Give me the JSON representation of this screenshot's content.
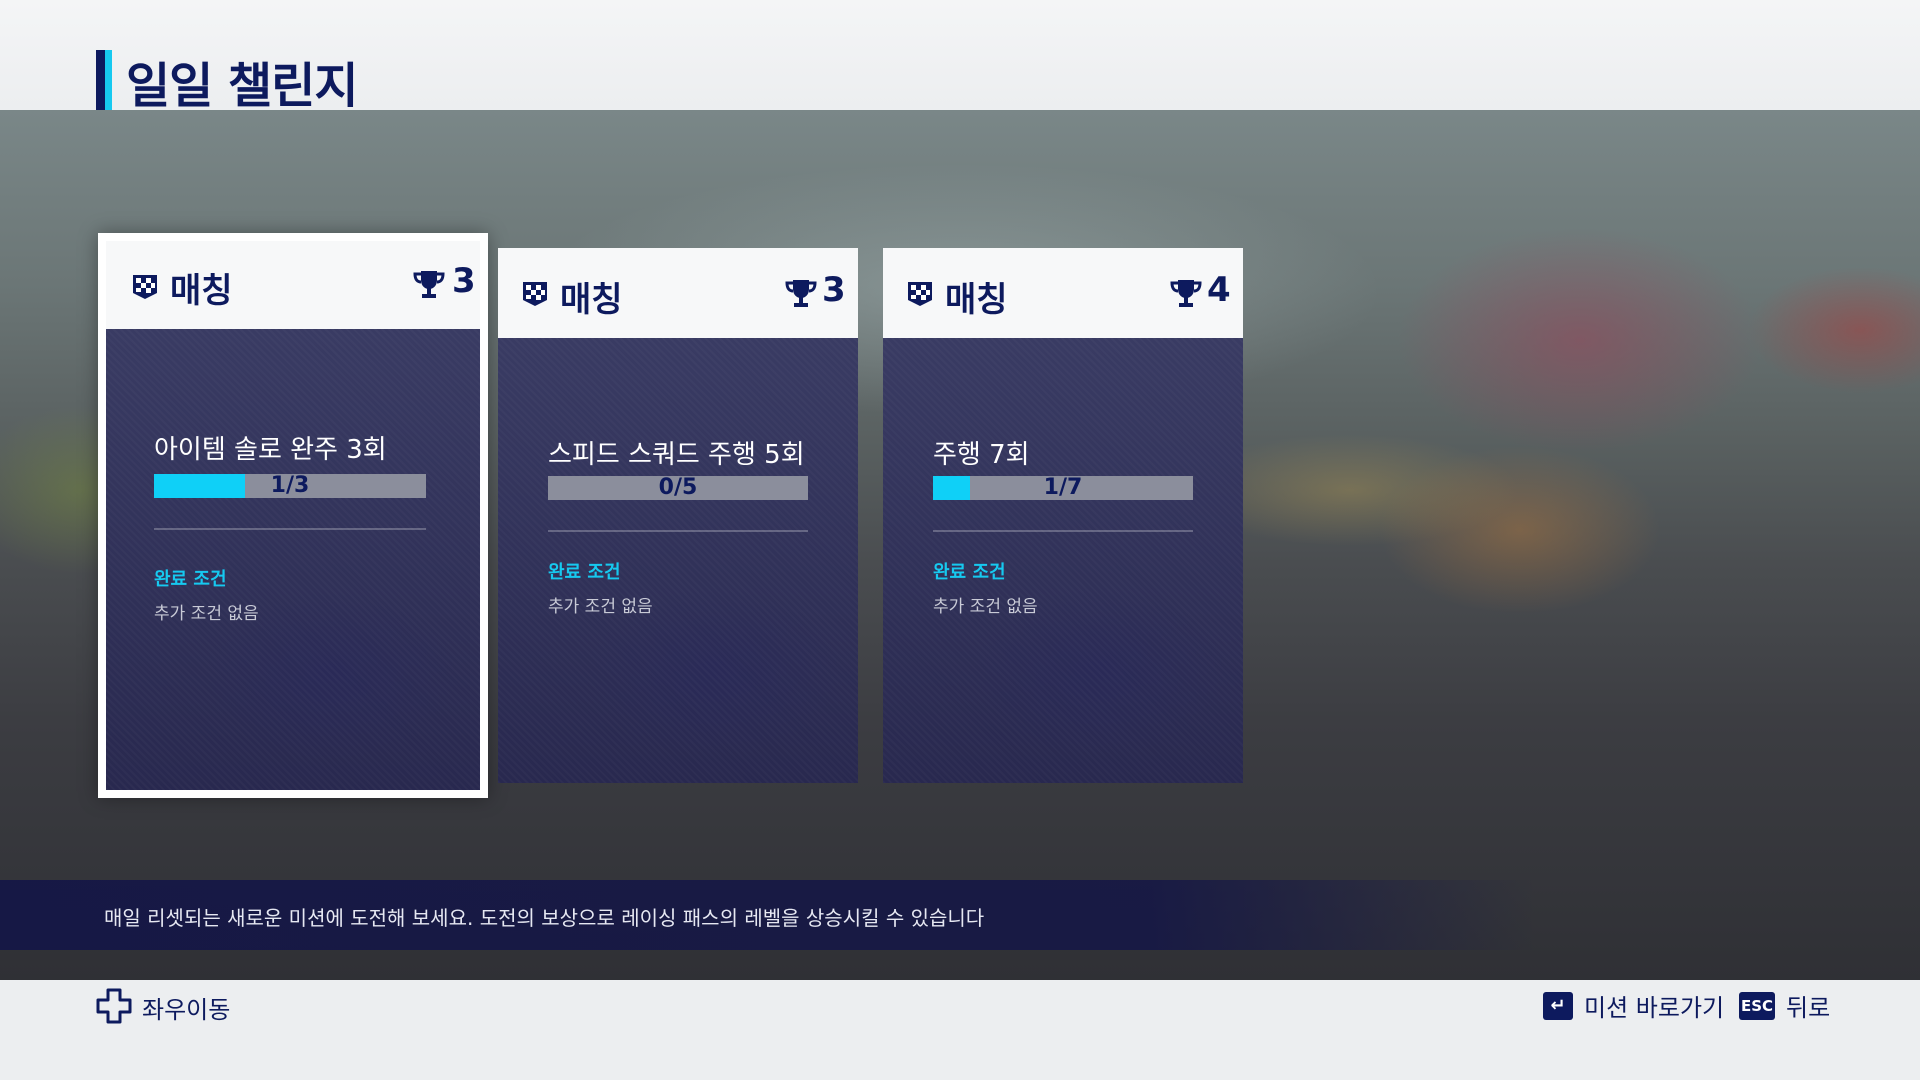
{
  "header": {
    "title": "일일 챌린지"
  },
  "cards": [
    {
      "mode": "매칭",
      "trophies": "3",
      "mission": "아이템 솔로 완주 3회",
      "progress_text": "1/3",
      "progress": 0.333,
      "condition_title": "완료 조건",
      "condition_text": "추가 조건 없음",
      "selected": true
    },
    {
      "mode": "매칭",
      "trophies": "3",
      "mission": "스피드 스쿼드 주행 5회",
      "progress_text": "0/5",
      "progress": 0,
      "condition_title": "완료 조건",
      "condition_text": "추가 조건 없음",
      "selected": false
    },
    {
      "mode": "매칭",
      "trophies": "4",
      "mission": "주행 7회",
      "progress_text": "1/7",
      "progress": 0.143,
      "condition_title": "완료 조건",
      "condition_text": "추가 조건 없음",
      "selected": false
    }
  ],
  "description": "매일 리셋되는 새로운 미션에 도전해 보세요. 도전의 보상으로 레이싱 패스의 레벨을 상승시킬 수 있습니다",
  "footer": {
    "move_label": "좌우이동",
    "enter_key": "↵",
    "shortcut_label": "미션 바로가기",
    "esc_key": "ESC",
    "back_label": "뒤로"
  },
  "colors": {
    "navy": "#0d1a5e",
    "accent_cyan": "#0fd0f7"
  },
  "icons": {
    "mode": "checkered-flag-icon",
    "reward": "trophy-icon",
    "move": "dpad-icon"
  }
}
